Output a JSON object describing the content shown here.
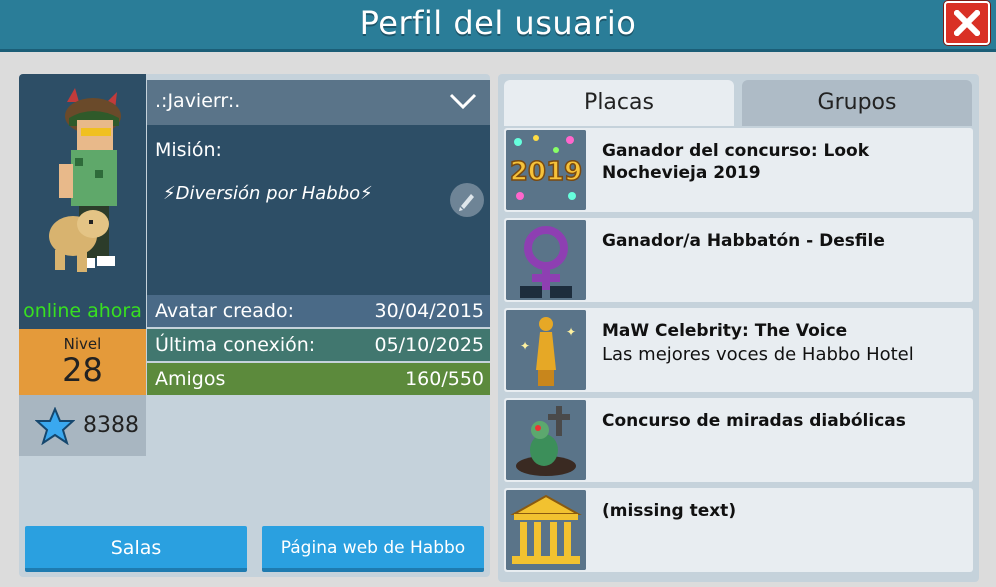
{
  "window": {
    "title": "Perfil del usuario"
  },
  "profile": {
    "name": ".:Javierr:.",
    "mission_label": "Misión:",
    "motto": "Diversión por Habbo",
    "status": "online ahora",
    "level_label": "Nivel",
    "level": "28",
    "points": "8388",
    "stats": [
      {
        "label": "Avatar creado:",
        "value": "30/04/2015"
      },
      {
        "label": "Última conexión:",
        "value": "05/10/2025"
      },
      {
        "label": "Amigos",
        "value": "160/550"
      }
    ]
  },
  "buttons": {
    "rooms": "Salas",
    "web": "Página web de Habbo"
  },
  "tabs": [
    {
      "label": "Placas",
      "active": true
    },
    {
      "label": "Grupos",
      "active": false
    }
  ],
  "badges": [
    {
      "title": "Ganador del concurso: Look Nochevieja 2019",
      "description": "",
      "icon": "badge-2019-icon"
    },
    {
      "title": "Ganador/a Habbatón - Desfile",
      "description": "",
      "icon": "badge-venus-icon"
    },
    {
      "title": "MaW Celebrity: The Voice",
      "description": "Las mejores voces de Habbo Hotel",
      "icon": "badge-statue-icon"
    },
    {
      "title": "Concurso de miradas diabólicas",
      "description": "",
      "icon": "badge-zombie-icon"
    },
    {
      "title": "(missing text)",
      "description": "",
      "icon": "badge-temple-icon"
    }
  ],
  "colors": {
    "titlebar": "#2a7d98",
    "close": "#d93025",
    "online": "#38e020",
    "level": "#e49a3a",
    "button": "#2aa0e0"
  }
}
